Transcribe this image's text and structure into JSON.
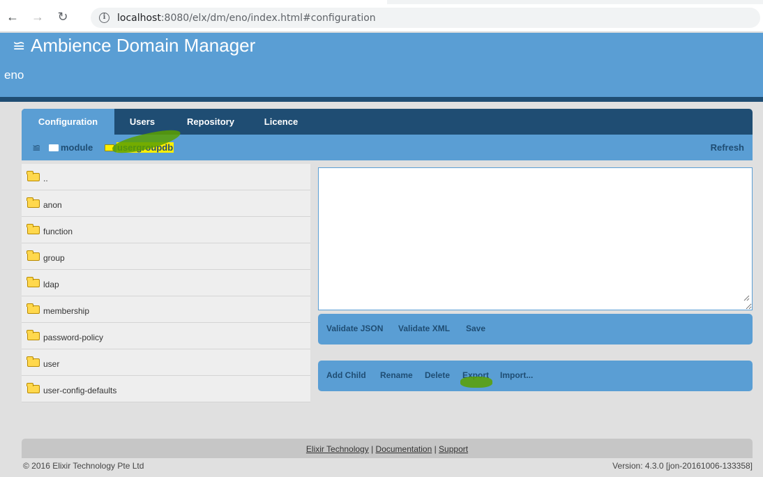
{
  "browser": {
    "url_host": "localhost",
    "url_rest": ":8080/elx/dm/eno/index.html#configuration"
  },
  "header": {
    "title": "Ambience Domain Manager",
    "domain": "eno"
  },
  "tabs": [
    {
      "label": "Configuration",
      "active": true
    },
    {
      "label": "Users",
      "active": false
    },
    {
      "label": "Repository",
      "active": false
    },
    {
      "label": "Licence",
      "active": false
    }
  ],
  "breadcrumb": {
    "items": [
      "module",
      "usergroupdb"
    ],
    "refresh_label": "Refresh"
  },
  "folders": [
    "..",
    "anon",
    "function",
    "group",
    "ldap",
    "membership",
    "password-policy",
    "user",
    "user-config-defaults"
  ],
  "editor": {
    "value": ""
  },
  "validate_actions": [
    "Validate JSON",
    "Validate XML",
    "Save"
  ],
  "node_actions": [
    "Add Child",
    "Rename",
    "Delete",
    "Export",
    "Import..."
  ],
  "footer": {
    "links": [
      "Elixir Technology",
      "Documentation",
      "Support"
    ],
    "copyright": "© 2016 Elixir Technology Pte Ltd",
    "version": "Version: 4.3.0 [jon-20161006-133358]"
  },
  "colors": {
    "header_blue": "#5a9ed4",
    "dark_navy": "#1f4d73",
    "highlight_yellow": "#ffef00",
    "marker_green": "#5aa000"
  }
}
